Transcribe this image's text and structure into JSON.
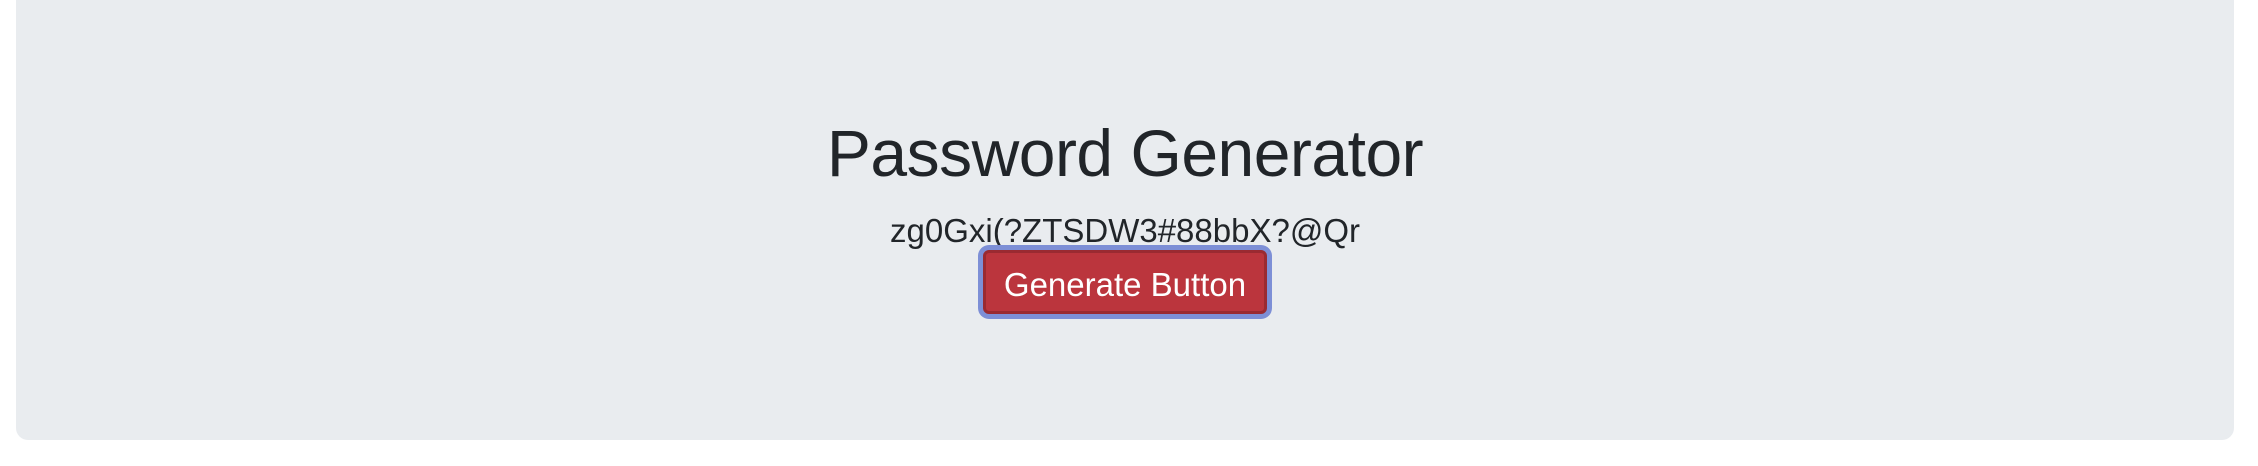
{
  "page": {
    "title": "Password Generator",
    "password": "zg0Gxi(?ZTSDW3#88bbX?@Qr",
    "generate_button_label": "Generate Button"
  },
  "colors": {
    "background": "#e9ecef",
    "text": "#212529",
    "button_bg": "#bb353d",
    "button_focus_ring": "#7d8fd6"
  }
}
